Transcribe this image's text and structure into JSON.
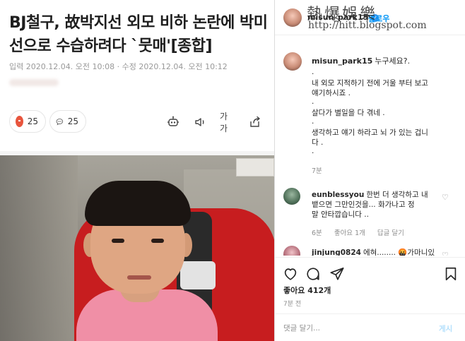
{
  "article": {
    "headline": "BJ철구, 故박지선 외모 비하 논란에 박미선으로 수습하려다 `뭇매'[종합]",
    "dates": "입력 2020.12.04. 오전 10:08 · 수정 2020.12.04. 오전 10:12",
    "reactions": {
      "angry_count": "25",
      "comment_count": "25"
    },
    "tools": {
      "font_label": "가가"
    }
  },
  "instagram": {
    "header": {
      "username": "misun_park15",
      "follow_label": "팔로우",
      "watermark_title": "熱爆娛樂",
      "watermark_url": "http://hitt.blogspot.com"
    },
    "caption": {
      "username": "misun_park15",
      "first_line": "누구세요?.",
      "lines": [
        ".",
        "내 외모 지적하기 전에 거울 부터 보고",
        "얘기하시죠 .",
        ".",
        "살다가 별일을 다 겪네 .",
        ".",
        "생각하고 얘기 하라고 뇌 가 있는 겁니",
        "다 .",
        "."
      ],
      "time": "7분"
    },
    "comments": [
      {
        "username": "eunblessyou",
        "lines": [
          "한번 더 생각하고 내",
          "뱉으면 그만인것을... 화가나고 정",
          "말 안타깝습니다 .."
        ],
        "meta": {
          "time": "6분",
          "likes": "좋아요 1개",
          "reply": "답글 달기"
        }
      },
      {
        "username": "jinjung0824",
        "text": "에혀........ 🤬가마니있"
      }
    ],
    "actions": {
      "likes": "좋아요 412개",
      "post_time": "7분 전"
    },
    "comment_box": {
      "placeholder": "댓글 달기...",
      "post_label": "게시"
    }
  }
}
